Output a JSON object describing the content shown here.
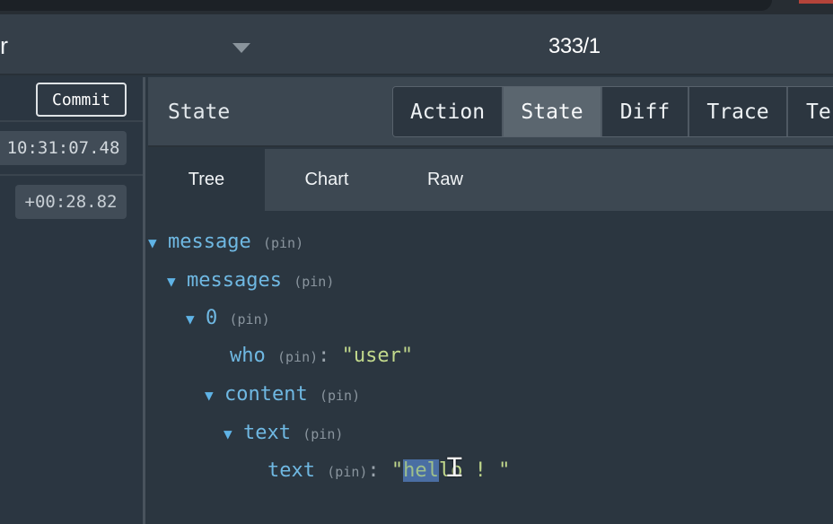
{
  "header": {
    "left_text": "r",
    "counter": "333/1"
  },
  "sidebar": {
    "commit_label": "Commit",
    "time": "10:31:07.48",
    "delta": "+00:28.82"
  },
  "panel": {
    "title": "State",
    "mode_tabs": [
      {
        "label": "Action",
        "active": false
      },
      {
        "label": "State",
        "active": true
      },
      {
        "label": "Diff",
        "active": false
      },
      {
        "label": "Trace",
        "active": false
      },
      {
        "label": "Te",
        "active": false
      }
    ],
    "sub_tabs": [
      {
        "label": "Tree",
        "active": true
      },
      {
        "label": "Chart",
        "active": false
      },
      {
        "label": "Raw",
        "active": false
      }
    ]
  },
  "tree": {
    "pin_label": "(pin)",
    "nodes": [
      {
        "key": "message"
      },
      {
        "key": "messages"
      },
      {
        "key": "0"
      },
      {
        "key": "who",
        "value": "\"user\""
      },
      {
        "key": "content"
      },
      {
        "key": "text"
      },
      {
        "key": "text",
        "value_quote": "\"",
        "value_selected": "hel",
        "value_rest": "lo ! \""
      }
    ]
  },
  "colors": {
    "key": "#6fb8e2",
    "string": "#c2d98c",
    "selection": "#4a6ea3",
    "background": "#2b3640"
  }
}
